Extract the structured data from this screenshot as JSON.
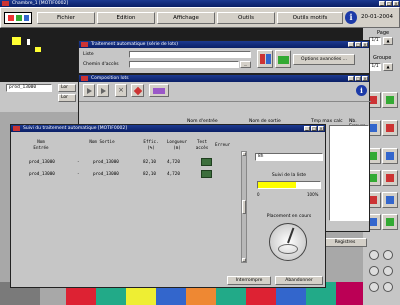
{
  "app": {
    "title": "Chambre_1 [MOTIF0002]"
  },
  "menu": {
    "fichier": "Fichier",
    "edition": "Edition",
    "affichage": "Affichage",
    "outils": "Outils",
    "outils_motifs": "Outils motifs",
    "date": "20-01-2004"
  },
  "right_panel": {
    "page_label": "Page",
    "page_value": "1/1",
    "groupe_label": "Groupe",
    "groupe_value": "1/1"
  },
  "left_panel": {
    "field_value": "prod_13000",
    "btn1": "Lor",
    "btn2": "Lor"
  },
  "dialog1": {
    "title": "Traitement automatique (série de lots)",
    "liste_label": "Liste",
    "chemin_label": "Chemin d'accès",
    "chemin_btn": "...",
    "options_btn": "Options avancées ..."
  },
  "dialog2": {
    "title": "Composition lots",
    "col_entree": "Nom d'entrée",
    "col_sortie": "Nom de sortie",
    "col_tmp": "Tmp max calc",
    "col_nb": "Nb. Erreurs",
    "registres_btn": "Registres"
  },
  "dialog3": {
    "title": "Suivi du traitement automatique [MOTIF0002]",
    "headers": {
      "entree": "Nom Entrée",
      "sortie": "Nom Sortie",
      "efficacite": "Effic. (%)",
      "longueur": "Longueur (m)",
      "test": "Test  accès",
      "erreur": "Erreur"
    },
    "rows": [
      {
        "entree": "prod_13000",
        "dash": "-",
        "sortie": "prod_13000",
        "efficacite": "82,10",
        "longueur": "4,720"
      },
      {
        "entree": "prod_13000",
        "dash": "-",
        "sortie": "prod_13000",
        "efficacite": "82,10",
        "longueur": "4,720"
      }
    ],
    "field_value": "8h",
    "suivi_label": "Suivi de la liste",
    "progress_start": "0",
    "progress_end": "100%",
    "progress_fraction": 0.62,
    "placement_label": "Placement en cours",
    "interrompre_btn": "Interrompre",
    "abandonner_btn": "Abandonner"
  },
  "colors": {
    "titlebar": "#0a1f66",
    "workspace": "#a8a8a8",
    "dark_band": "#1e1e1e",
    "progress": "#ffff00",
    "accent_yellow": "#ffff33"
  }
}
